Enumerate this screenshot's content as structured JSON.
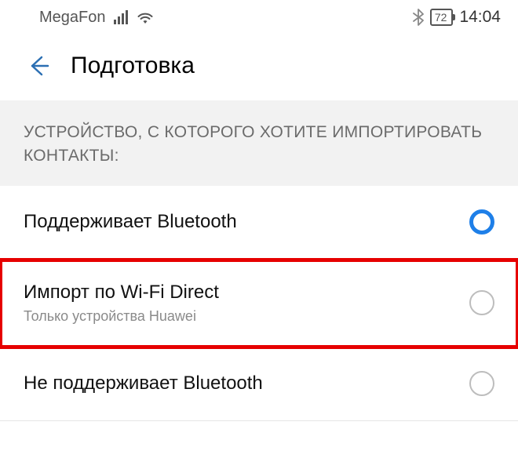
{
  "status": {
    "carrier": "MegaFon",
    "battery": "72",
    "time": "14:04"
  },
  "header": {
    "title": "Подготовка"
  },
  "section": {
    "heading": "УСТРОЙСТВО, С КОТОРОГО ХОТИТЕ ИМПОРТИРОВАТЬ КОНТАКТЫ:"
  },
  "options": {
    "bluetooth": {
      "label": "Поддерживает Bluetooth"
    },
    "wifi_direct": {
      "label": "Импорт по Wi-Fi Direct",
      "sub": "Только устройства Huawei"
    },
    "no_bluetooth": {
      "label": "Не поддерживает Bluetooth"
    }
  }
}
